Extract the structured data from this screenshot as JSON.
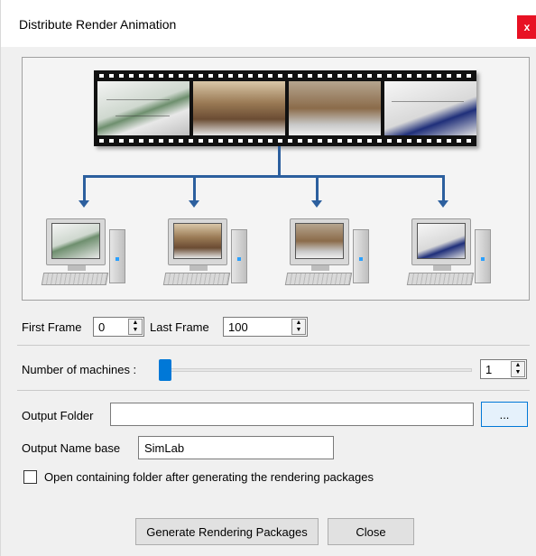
{
  "window": {
    "title": "Distribute Render Animation",
    "close_label": "x"
  },
  "illustration": {
    "icons": [
      "film-strip-icon",
      "computer-icon"
    ],
    "colors": {
      "connector": "#2c5f9e",
      "film": "#111111",
      "close_button": "#e81123",
      "slider_thumb": "#0078d7"
    }
  },
  "frames": {
    "first_label": "First Frame",
    "first_value": "0",
    "last_label": "Last Frame",
    "last_value": "100"
  },
  "machines": {
    "label": "Number of machines :",
    "value": "1",
    "slider_fraction": 0
  },
  "output": {
    "folder_label": "Output Folder",
    "folder_value": "",
    "browse_label": "...",
    "name_label": "Output Name base",
    "name_value": "SimLab",
    "open_folder_label": "Open containing folder after generating the rendering packages",
    "open_folder_checked": false
  },
  "buttons": {
    "generate_label": "Generate Rendering Packages",
    "close_label": "Close"
  }
}
